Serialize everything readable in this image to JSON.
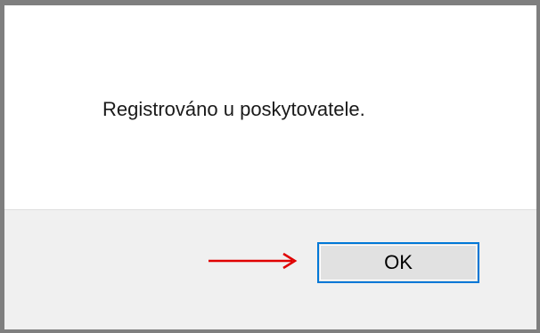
{
  "dialog": {
    "message": "Registrováno u poskytovatele.",
    "ok_label": "OK"
  },
  "colors": {
    "border": "#7f7f7f",
    "footer_bg": "#f0f0f0",
    "button_border": "#0078d7",
    "button_bg": "#e1e1e1",
    "arrow": "#e00000"
  },
  "annotation": {
    "icon": "arrow-right-icon"
  }
}
